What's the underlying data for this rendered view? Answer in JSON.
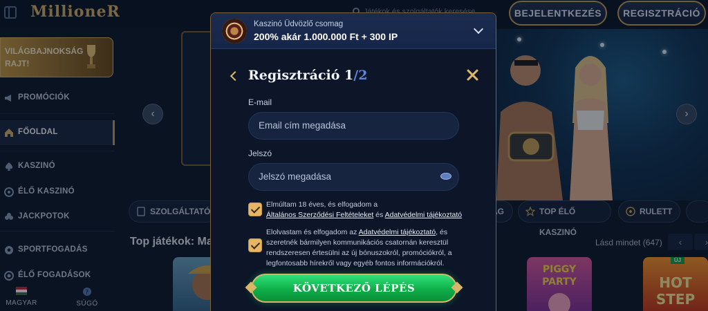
{
  "header": {
    "logo": "MillioneR",
    "search_placeholder": "Játékok és szolgáltatók keresése",
    "login_label": "BEJELENTKEZÉS",
    "register_label": "REGISZTRÁCIÓ"
  },
  "sidebar": {
    "promo": "VILÁGBAJNOKSÁG RAJT!",
    "items": [
      {
        "label": "PROMÓCIÓK",
        "icon": "megaphone-icon"
      },
      {
        "label": "FŐOLDAL",
        "icon": "home-icon"
      },
      {
        "label": "KASZINÓ",
        "icon": "spade-icon"
      },
      {
        "label": "ÉLŐ KASZINÓ",
        "icon": "chip-icon"
      },
      {
        "label": "JACKPOTOK",
        "icon": "clover-icon"
      },
      {
        "label": "SPORTFOGADÁS",
        "icon": "soccer-ball-icon"
      },
      {
        "label": "ÉLŐ FOGADÁSOK",
        "icon": "live-icon"
      }
    ],
    "language_label": "MAGYAR",
    "help_label": "SÚGÓ"
  },
  "main": {
    "chips": [
      "SZOLGÁLTATÓK",
      "AG",
      "TOP ÉLŐ KASZINÓ",
      "RULETT"
    ],
    "section_title": "Top játékok: Ma",
    "see_all": "Lásd mindet (647)",
    "new_badge": "ÚJ"
  },
  "modal": {
    "bonus_subtitle": "Kaszinó Üdvözlő csomag",
    "bonus_title": "200% akár 1.000.000 Ft + 300 IP",
    "title": "Regisztráció 1",
    "title_step": "/2",
    "email_label": "E-mail",
    "email_placeholder": "Email cím megadása",
    "password_label": "Jelszó",
    "password_placeholder": "Jelszó megadása",
    "consent1_text": "Elmúltam 18 éves, és elfogadom a",
    "consent1_link1": "Általános Szerződési Feltételeket",
    "consent1_and": "és",
    "consent1_link2": "Adatvédelmi tájékoztató",
    "consent2_text1": "Elolvastam és elfogadom az",
    "consent2_link": "Adatvédelmi tájékoztató",
    "consent2_text2": ", és szeretnék bármilyen kommunikációs csatornán keresztül rendszeresen értesülni az új bónuszokról, promóciókról, a legfontosabb hírekről vagy egyéb fontos információkról.",
    "next_button": "KÖVETKEZŐ LÉPÉS"
  },
  "colors": {
    "accent_gold": "#c9a45a",
    "cta_green": "#0fae48",
    "background": "#0f1a2e"
  }
}
